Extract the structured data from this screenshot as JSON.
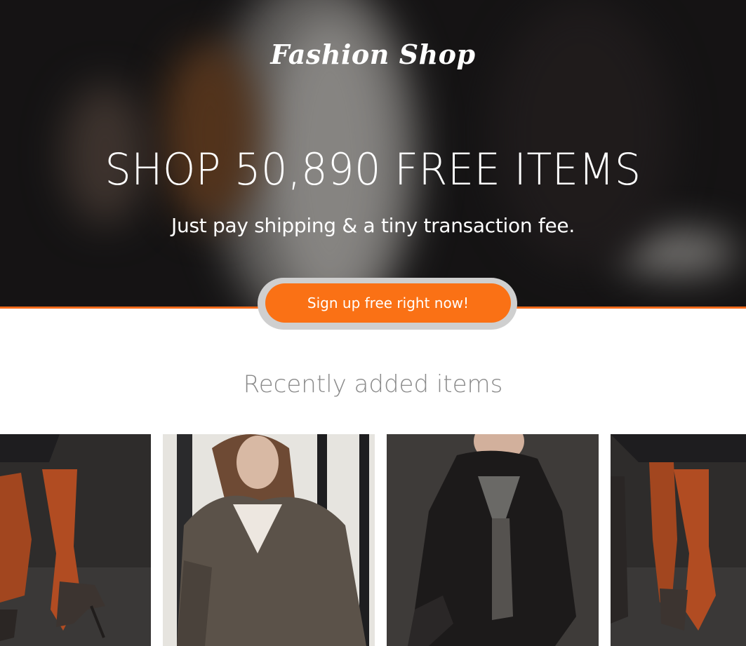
{
  "hero": {
    "logo": "Fashion Shop",
    "headline": "SHOP 50,890 FREE ITEMS",
    "subline": "Just pay shipping & a tiny transaction fee.",
    "cta_label": "Sign up free right now!"
  },
  "section": {
    "title": "Recently added items"
  },
  "items": [
    {
      "image": "photo-legs-orange-stockings"
    },
    {
      "image": "photo-woman-trench-coat"
    },
    {
      "image": "photo-woman-leather-jacket"
    },
    {
      "image": "photo-legs-orange-stockings"
    }
  ],
  "colors": {
    "accent": "#fa7115",
    "accent_line": "#f26a1b",
    "hero_dark": "#1c1a1b",
    "title_gray": "#8a8a8a"
  }
}
